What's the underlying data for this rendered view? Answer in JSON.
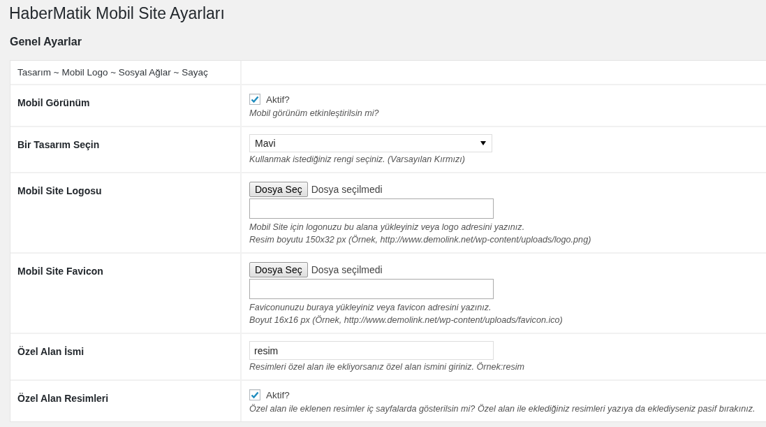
{
  "page_title": "HaberMatik Mobil Site Ayarları",
  "section_title": "Genel Ayarlar",
  "settings_table": {
    "header": "Tasarım ~ Mobil Logo ~ Sosyal Ağlar ~ Sayaç",
    "rows": [
      {
        "kind": "checkbox",
        "label": "Mobil Görünüm",
        "checkbox_label": "Aktif?",
        "checked": true,
        "description": [
          "Mobil görünüm etkinleştirilsin mi?"
        ]
      },
      {
        "kind": "select",
        "label": "Bir Tasarım Seçin",
        "value": "Mavi",
        "description": [
          "Kullanmak istediğiniz rengi seçiniz. (Varsayılan Kırmızı)"
        ]
      },
      {
        "kind": "file",
        "label": "Mobil Site Logosu",
        "button": "Dosya Seç",
        "file_status": "Dosya seçilmedi",
        "description": [
          "Mobil Site için logonuzu bu alana yükleyiniz veya logo adresini yazınız.",
          "Resim boyutu 150x32 px (Örnek, http://www.demolink.net/wp-content/uploads/logo.png)"
        ]
      },
      {
        "kind": "file",
        "label": "Mobil Site Favicon",
        "button": "Dosya Seç",
        "file_status": "Dosya seçilmedi",
        "description": [
          "Faviconunuzu buraya yükleyiniz veya favicon adresini yazınız.",
          "Boyut 16x16 px (Örnek, http://www.demolink.net/wp-content/uploads/favicon.ico)"
        ]
      },
      {
        "kind": "text",
        "label": "Özel Alan İsmi",
        "value": "resim",
        "description": [
          "Resimleri özel alan ile ekliyorsanız özel alan ismini giriniz. Örnek:resim"
        ]
      },
      {
        "kind": "checkbox",
        "label": "Özel Alan Resimleri",
        "checkbox_label": "Aktif?",
        "checked": true,
        "description": [
          "Özel alan ile eklenen resimler iç sayfalarda gösterilsin mi? Özel alan ile eklediğiniz resimleri yazıya da eklediyseniz pasif bırakınız."
        ]
      }
    ]
  }
}
